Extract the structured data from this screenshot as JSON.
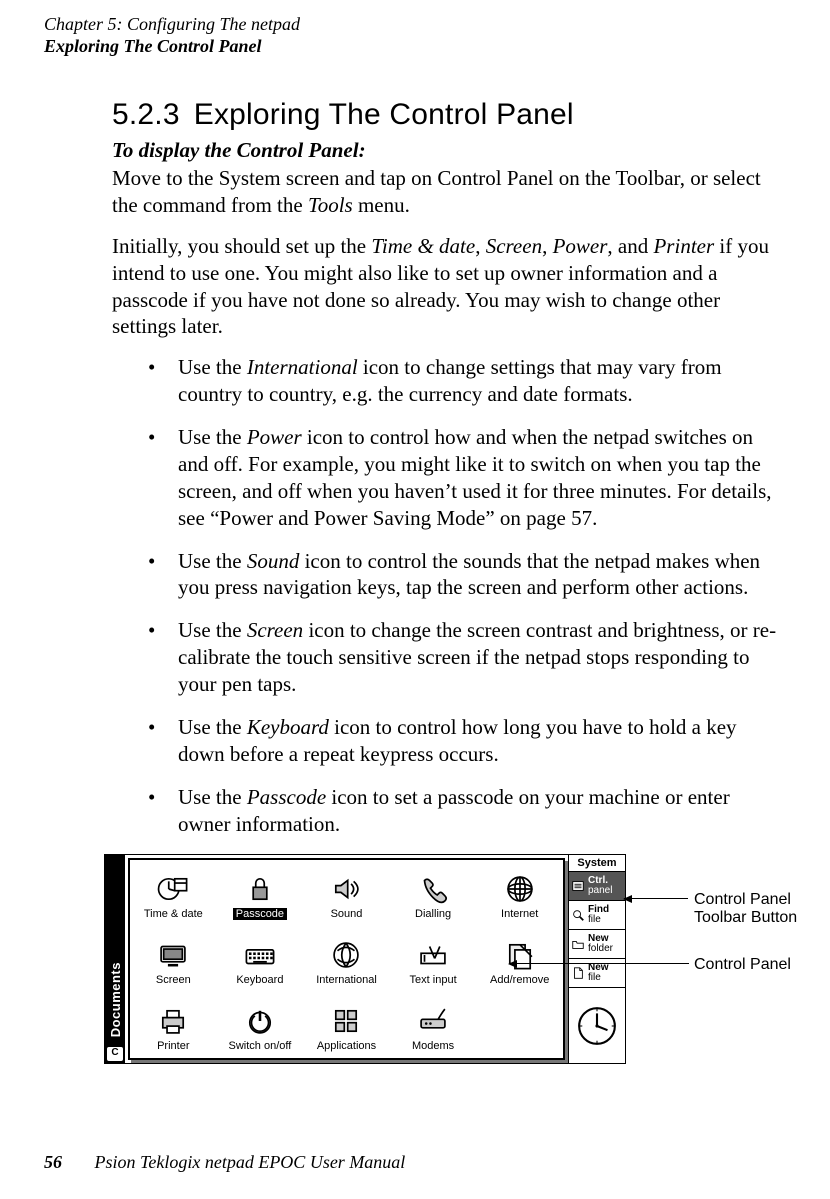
{
  "header": {
    "chapter": "Chapter 5:  Configuring The netpad",
    "section": "Exploring The Control Panel"
  },
  "heading": {
    "number": "5.2.3",
    "title": "Exploring The Control Panel"
  },
  "subhead": "To display the Control Panel:",
  "intro1": "Move to the System screen and tap on Control Panel on the Toolbar, or select the command from the ",
  "intro1_em": "Tools",
  "intro1_tail": " menu.",
  "para2_parts": [
    {
      "t": "Initially, you should set up the "
    },
    {
      "t": "Time & date",
      "em": true
    },
    {
      "t": ", "
    },
    {
      "t": "Screen",
      "em": true
    },
    {
      "t": ", "
    },
    {
      "t": "Power",
      "em": true
    },
    {
      "t": ", and "
    },
    {
      "t": "Printer",
      "em": true
    },
    {
      "t": " if you intend to use one. You might also like to set up owner information and a passcode if you have not done so already. You may wish to change other settings later."
    }
  ],
  "bullets": [
    [
      {
        "t": "Use the "
      },
      {
        "t": "International",
        "em": true
      },
      {
        "t": " icon to change settings that may vary from country to country, e.g. the currency and date formats."
      }
    ],
    [
      {
        "t": "Use the "
      },
      {
        "t": "Power",
        "em": true
      },
      {
        "t": " icon to control how and when the netpad switches on and off. For example, you might like it to switch on when you tap the screen, and off when you haven’t used it for three minutes. For details, see “Power and Power Saving Mode” on page 57."
      }
    ],
    [
      {
        "t": "Use the "
      },
      {
        "t": "Sound",
        "em": true
      },
      {
        "t": " icon to control the sounds that the netpad makes when you press navigation keys, tap the screen and perform other actions."
      }
    ],
    [
      {
        "t": "Use the "
      },
      {
        "t": "Screen",
        "em": true
      },
      {
        "t": " icon to change the screen contrast and brightness, or re-calibrate the touch sensitive screen if the netpad stops responding to your pen taps."
      }
    ],
    [
      {
        "t": "Use the "
      },
      {
        "t": "Keyboard",
        "em": true
      },
      {
        "t": " icon to control how long you have to hold a key down before a repeat keypress occurs."
      }
    ],
    [
      {
        "t": "Use the "
      },
      {
        "t": "Passcode",
        "em": true
      },
      {
        "t": " icon to set a passcode on your machine or enter owner information."
      }
    ]
  ],
  "screenshot": {
    "docstrip": {
      "label": "Documents",
      "corner": "C"
    },
    "icons": [
      {
        "name": "time-date",
        "label": "Time & date"
      },
      {
        "name": "passcode",
        "label": "Passcode",
        "selected": true
      },
      {
        "name": "sound",
        "label": "Sound"
      },
      {
        "name": "dialling",
        "label": "Dialling"
      },
      {
        "name": "internet",
        "label": "Internet"
      },
      {
        "name": "screen",
        "label": "Screen"
      },
      {
        "name": "keyboard",
        "label": "Keyboard"
      },
      {
        "name": "international",
        "label": "International"
      },
      {
        "name": "text-input",
        "label": "Text input"
      },
      {
        "name": "add-remove",
        "label": "Add/remove"
      },
      {
        "name": "printer",
        "label": "Printer"
      },
      {
        "name": "switch-on-off",
        "label": "Switch on/off"
      },
      {
        "name": "applications",
        "label": "Applications"
      },
      {
        "name": "modems",
        "label": "Modems"
      }
    ],
    "sidebar": {
      "title": "System",
      "buttons": [
        {
          "name": "ctrl-panel",
          "line1": "Ctrl.",
          "line2": "panel",
          "selected": true
        },
        {
          "name": "find-file",
          "line1": "Find",
          "line2": "file"
        },
        {
          "name": "new-folder",
          "line1": "New",
          "line2": "folder"
        },
        {
          "name": "new-file",
          "line1": "New",
          "line2": "file"
        }
      ]
    }
  },
  "callouts": {
    "a": "Control Panel Toolbar Button",
    "b": "Control Panel"
  },
  "footer": {
    "page": "56",
    "title": "Psion Teklogix netpad EPOC User Manual"
  }
}
